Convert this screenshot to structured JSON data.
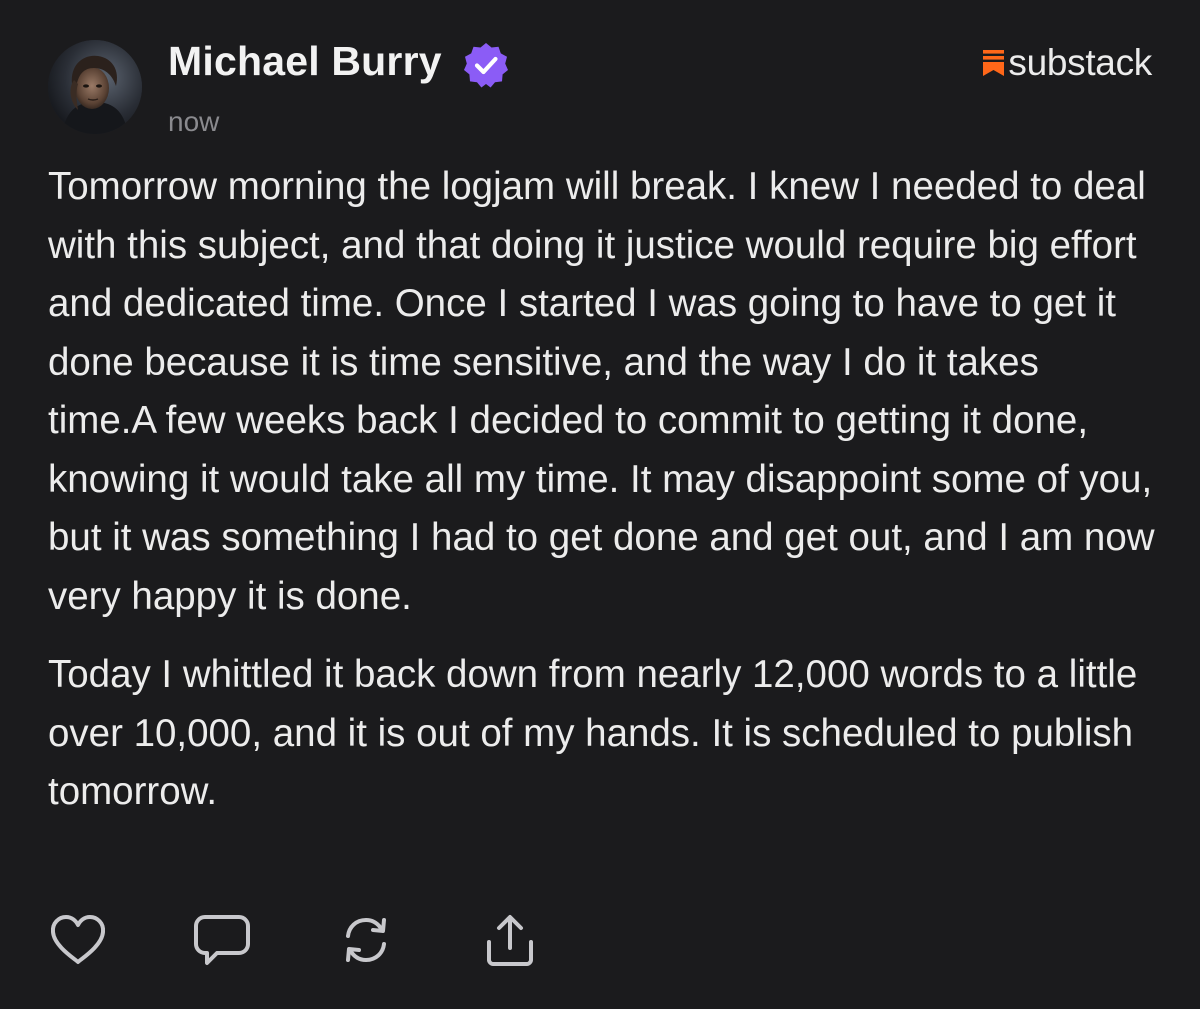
{
  "post": {
    "author": {
      "name": "Michael Burry",
      "verified": true,
      "avatar_icon": "profile-photo"
    },
    "timestamp": "now",
    "platform": {
      "name": "substack",
      "brand_color": "#ff6719"
    },
    "paragraphs": [
      "Tomorrow morning the logjam will break. I knew I needed to deal with this subject, and that doing it justice would require big effort and dedicated time. Once I started I was going to have to get it done because it is time sensitive, and the way I do it takes time.A few weeks back I decided to commit to getting it done, knowing it would take all my time. It may disappoint some of you, but it was something I had to get done and get out, and I am now very happy it is done.",
      "Today I whittled it back down from nearly 12,000 words to a little over 10,000, and it is out of my hands. It is scheduled to publish tomorrow."
    ],
    "actions": [
      {
        "name": "like",
        "icon": "heart-icon"
      },
      {
        "name": "comment",
        "icon": "comment-icon"
      },
      {
        "name": "restack",
        "icon": "restack-icon"
      },
      {
        "name": "share",
        "icon": "share-icon"
      }
    ]
  },
  "colors": {
    "background": "#1b1b1d",
    "text": "#ececec",
    "muted": "#8a8a8e",
    "verified_badge": "#8b5cf6",
    "icon": "#c8c8cc"
  }
}
